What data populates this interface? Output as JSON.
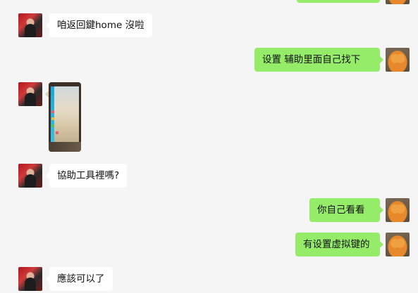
{
  "colors": {
    "background": "#f5f5f5",
    "incoming_bubble": "#ffffff",
    "outgoing_bubble": "#95ec69"
  },
  "messages": [
    {
      "sender": "other",
      "type": "text",
      "text": "咱返回鍵home 沒啦"
    },
    {
      "sender": "me",
      "type": "text",
      "text": "设置  辅助里面自己找下"
    },
    {
      "sender": "other",
      "type": "image"
    },
    {
      "sender": "other",
      "type": "text",
      "text": "協助工具裡嗎?"
    },
    {
      "sender": "me",
      "type": "text",
      "text": "你自己看看"
    },
    {
      "sender": "me",
      "type": "text",
      "text": "有设置虚拟键的"
    },
    {
      "sender": "other",
      "type": "text",
      "text": "應該可以了"
    }
  ]
}
